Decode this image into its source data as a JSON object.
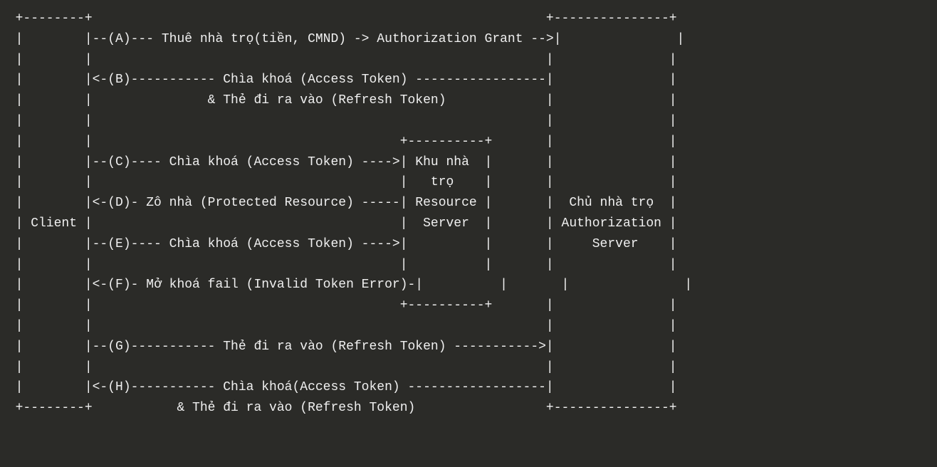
{
  "diagram": {
    "lines": [
      "  +--------+                                                           +---------------+",
      "  |        |--(A)--- Thuê nhà trọ(tiền, CMND) -> Authorization Grant -->|               |",
      "  |        |                                                           |               |",
      "  |        |<-(B)----------- Chìa khoá (Access Token) -----------------|               |",
      "  |        |               & Thẻ đi ra vào (Refresh Token)             |               |",
      "  |        |                                                           |               |",
      "  |        |                                        +----------+       |               |",
      "  |        |--(C)---- Chìa khoá (Access Token) ---->| Khu nhà  |       |               |",
      "  |        |                                        |   trọ    |       |               |",
      "  |        |<-(D)- Zô nhà (Protected Resource) -----| Resource |       |  Chủ nhà trọ  |",
      "  | Client |                                        |  Server  |       | Authorization |",
      "  |        |--(E)---- Chìa khoá (Access Token) ---->|          |       |     Server    |",
      "  |        |                                        |          |       |               |",
      "  |        |<-(F)- Mở khoá fail (Invalid Token Error)-|          |       |               |",
      "  |        |                                        +----------+       |               |",
      "  |        |                                                           |               |",
      "  |        |--(G)----------- Thẻ đi ra vào (Refresh Token) ----------->|               |",
      "  |        |                                                           |               |",
      "  |        |<-(H)----------- Chìa khoá(Access Token) ------------------|               |",
      "  +--------+           & Thẻ đi ra vào (Refresh Token)                 +---------------+"
    ]
  }
}
